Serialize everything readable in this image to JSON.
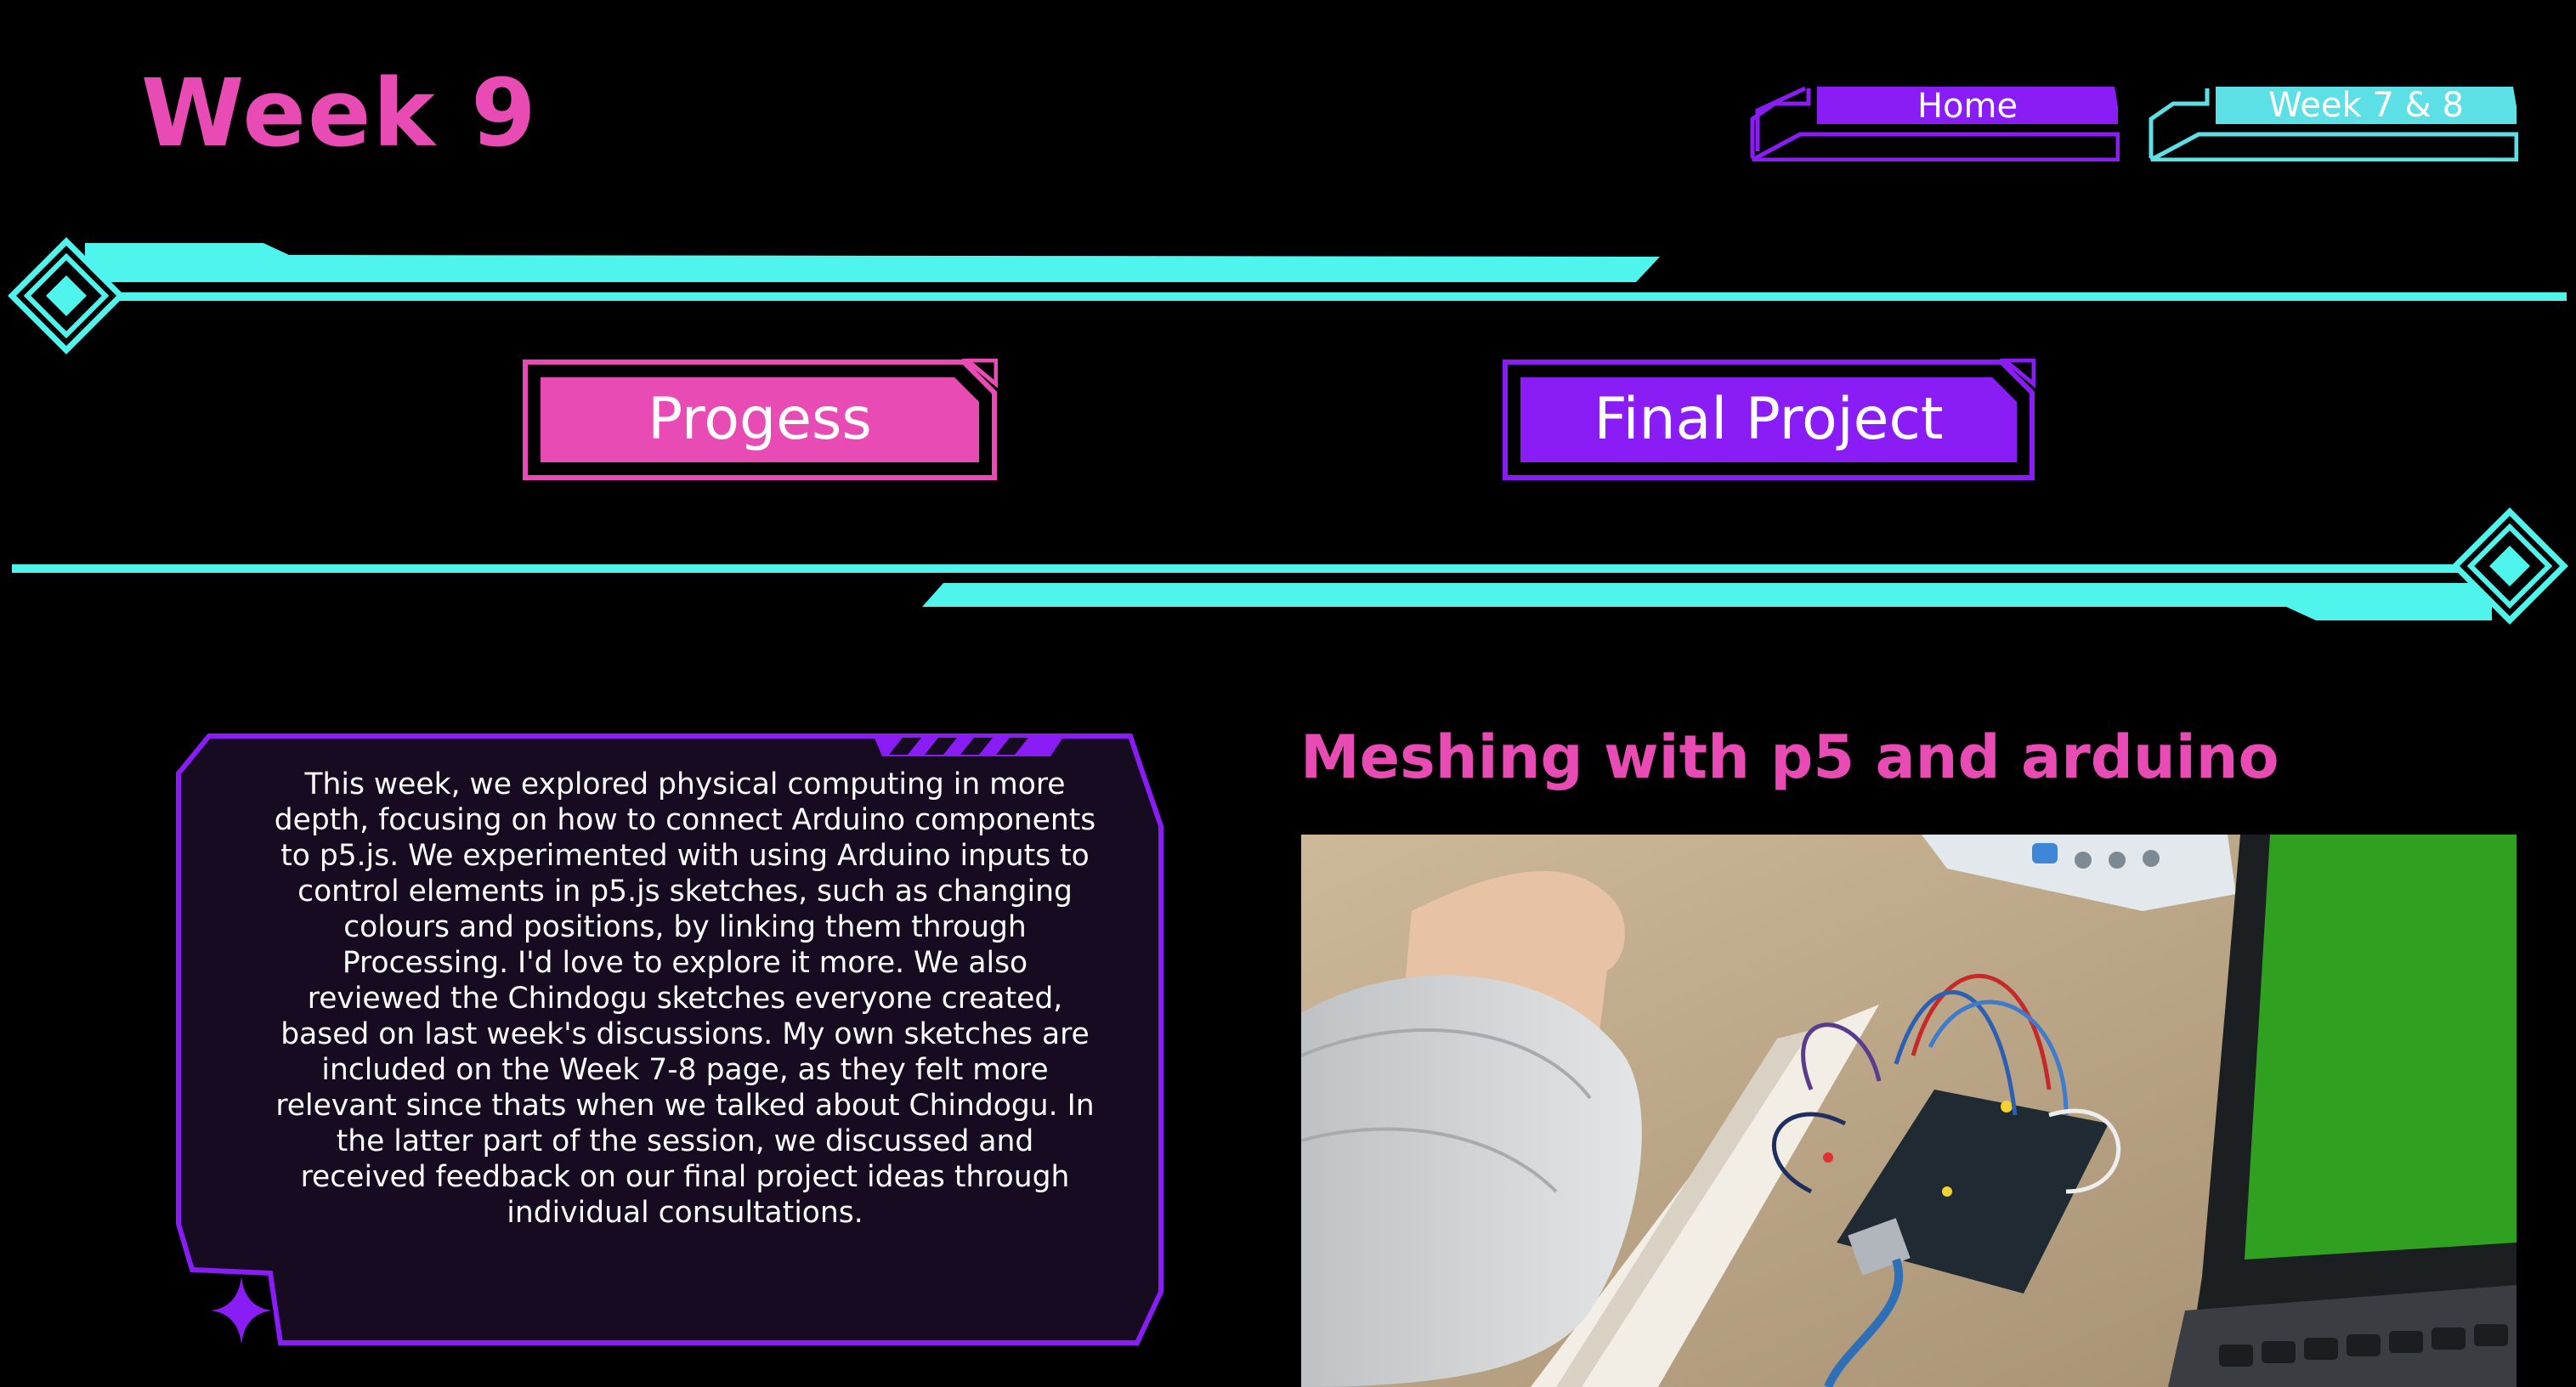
{
  "page": {
    "title": "Week 9"
  },
  "nav": {
    "home_label": "Home",
    "week78_label": "Week 7 & 8"
  },
  "buttons": {
    "progress_label": "Progess",
    "final_project_label": "Final Project"
  },
  "intro": {
    "text": "This week, we explored physical computing in more depth, focusing on how to connect Arduino components to p5.js. We experimented with using Arduino inputs to control elements in p5.js sketches, such as changing colours and positions, by linking them through Processing. I'd love to explore it more. We also reviewed the Chindogu sketches everyone created, based on last week's discussions. My own sketches are included on the Week 7-8 page, as they felt more relevant since thats when we talked about Chindogu. In the latter part of the session, we discussed and received feedback on our final project ideas through individual consultations."
  },
  "section": {
    "heading": "Meshing with p5 and arduino"
  },
  "colors": {
    "pink": "#e94bb4",
    "purple": "#8a1cf5",
    "cyan": "#4ff5ec",
    "panel_bg": "#170b22",
    "background": "#000000"
  },
  "icons": {
    "left_diamond": "diamond-icon",
    "right_diamond": "diamond-icon",
    "sparkle": "sparkle-icon"
  }
}
